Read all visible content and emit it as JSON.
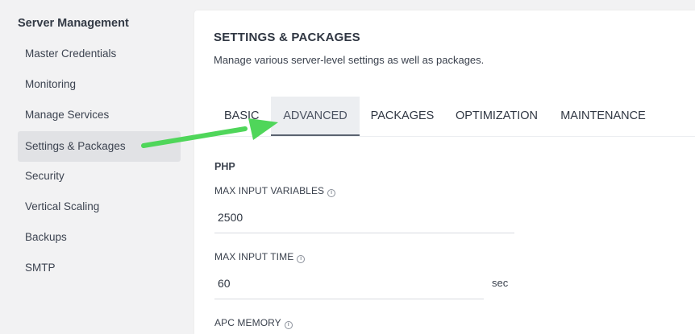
{
  "sidebar": {
    "title": "Server Management",
    "items": [
      {
        "label": "Master Credentials"
      },
      {
        "label": "Monitoring"
      },
      {
        "label": "Manage Services"
      },
      {
        "label": "Settings & Packages"
      },
      {
        "label": "Security"
      },
      {
        "label": "Vertical Scaling"
      },
      {
        "label": "Backups"
      },
      {
        "label": "SMTP"
      }
    ],
    "active_item": "Settings & Packages"
  },
  "panel": {
    "title": "SETTINGS & PACKAGES",
    "subtitle": "Manage various server-level settings as well as packages.",
    "tabs": [
      {
        "label": "BASIC"
      },
      {
        "label": "ADVANCED"
      },
      {
        "label": "PACKAGES"
      },
      {
        "label": "OPTIMIZATION"
      },
      {
        "label": "MAINTENANCE"
      }
    ],
    "active_tab": "ADVANCED",
    "section": "PHP",
    "fields": [
      {
        "label": "MAX INPUT VARIABLES",
        "value": "2500",
        "unit": ""
      },
      {
        "label": "MAX INPUT TIME",
        "value": "60",
        "unit": "sec"
      },
      {
        "label": "APC MEMORY",
        "value": "",
        "unit": ""
      }
    ]
  },
  "annotation": {
    "arrow_color": "#4fd65a"
  },
  "colors": {
    "background": "#f2f2f3",
    "panel": "#ffffff",
    "active_item": "#e1e2e5"
  }
}
